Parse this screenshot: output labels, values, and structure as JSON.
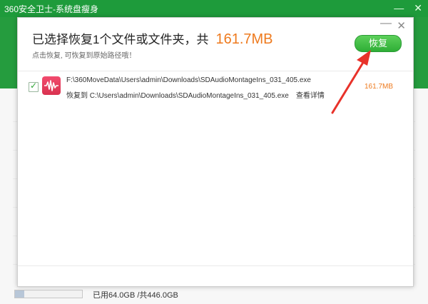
{
  "app": {
    "title": "360安全卫士-系统盘瘦身",
    "minimize_glyph": "—",
    "close_glyph": "✕",
    "disk_usage": "已用64.0GB /共446.0GB",
    "disk_used_fraction": 0.143
  },
  "dialog": {
    "heading": "已选择恢复1个文件或文件夹，共",
    "total_size": "161.7MB",
    "subtitle": "点击恢复, 可恢复到原始路径哦！",
    "restore_label": "恢复",
    "minimize_glyph": "—",
    "close_glyph": "✕"
  },
  "files": [
    {
      "checked": true,
      "icon": "audio-waveform-icon",
      "path": "F:\\360MoveData\\Users\\admin\\Downloads\\SDAudioMontageIns_031_405.exe",
      "restore_to": "恢复到 C:\\Users\\admin\\Downloads\\SDAudioMontageIns_031_405.exe",
      "details_label": "查看详情",
      "size": "161.7MB"
    }
  ],
  "colors": {
    "brand_green": "#259c3e",
    "accent_orange": "#ee7a1e",
    "annotation_red": "#e8322a"
  }
}
